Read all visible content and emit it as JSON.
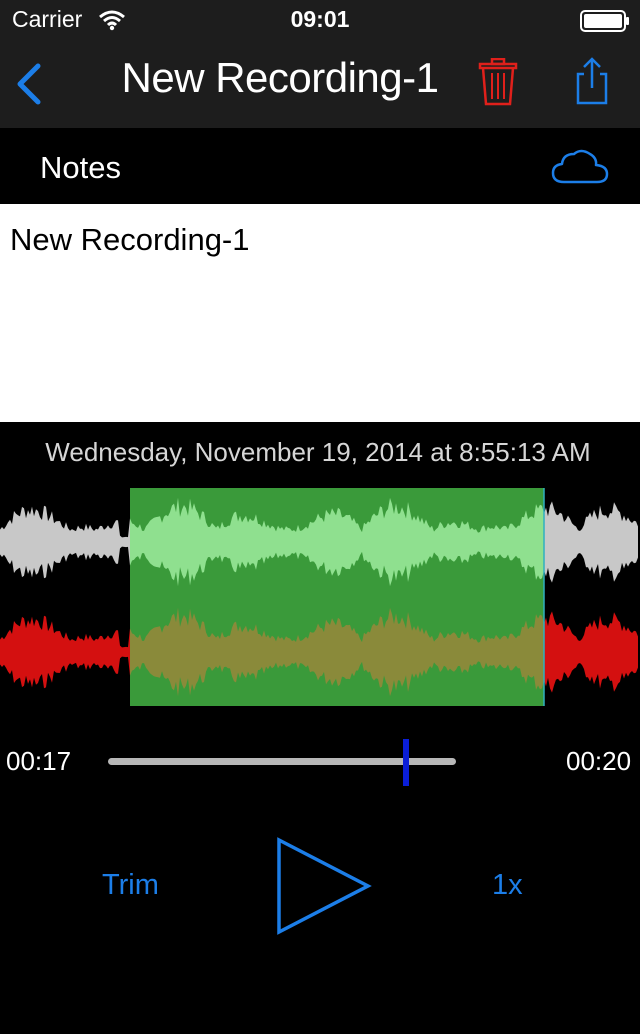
{
  "status_bar": {
    "carrier": "Carrier",
    "time": "09:01"
  },
  "nav": {
    "title": "New Recording-1",
    "icons": [
      "back-chevron-icon",
      "trash-icon",
      "share-icon"
    ]
  },
  "notes": {
    "header": "Notes",
    "text": "New Recording-1",
    "icon": "cloud-icon"
  },
  "recording": {
    "date": "Wednesday, November 19, 2014 at 8:55:13 AM"
  },
  "playback": {
    "elapsed": "00:17",
    "total": "00:20",
    "progress": 0.85,
    "trim_label": "Trim",
    "speed_label": "1x",
    "trim_selection": {
      "start_fraction": 0.2,
      "end_fraction": 0.85
    }
  },
  "colors": {
    "accent": "#1c7ee8",
    "trash": "#e0201b",
    "waveform_top": "#c8c8c8",
    "waveform_bottom": "#d41010",
    "selection": "#3a9a3a",
    "selection_wave_top": "#8fe08f",
    "selection_wave_bottom": "#8a8a3a",
    "scrub_thumb": "#0a1ed8"
  }
}
